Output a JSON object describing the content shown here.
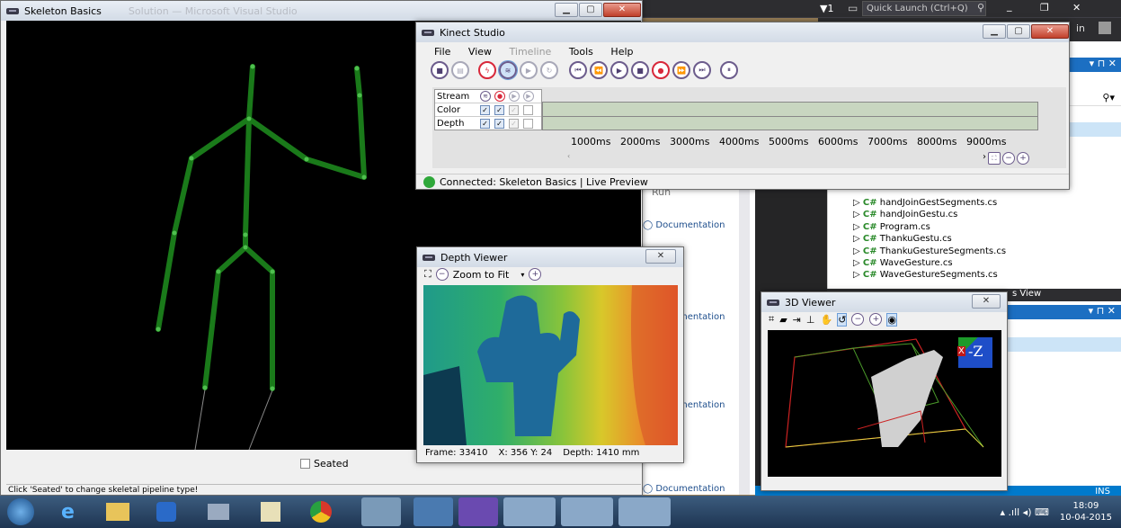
{
  "taskbar_top": {
    "badge": "▼1",
    "quick_launch": "Quick Launch (Ctrl+Q)",
    "user_partial": "in"
  },
  "skeleton": {
    "title": "Skeleton Basics",
    "title_ghost": "Solution — Microsoft Visual Studio",
    "seated_label": "Seated",
    "status": "Click 'Seated' to change skeletal pipeline type!"
  },
  "kinect": {
    "title": "Kinect Studio",
    "menu": [
      "File",
      "View",
      "Timeline",
      "Tools",
      "Help"
    ],
    "stream_rows": [
      {
        "label": "Stream"
      },
      {
        "label": "Color"
      },
      {
        "label": "Depth"
      }
    ],
    "ticks": [
      "1000ms",
      "2000ms",
      "3000ms",
      "4000ms",
      "5000ms",
      "6000ms",
      "7000ms",
      "8000ms",
      "9000ms"
    ],
    "status": "Connected:  Skeleton Basics | Live Preview"
  },
  "vs_mid": {
    "items": [
      "Run",
      "Documentation",
      "Documentation",
      "Documentation",
      "Documentation"
    ]
  },
  "solution": {
    "files": [
      "handJoinGestSegments.cs",
      "handJoinGestu.cs",
      "Program.cs",
      "ThankuGestu.cs",
      "ThankuGestureSegments.cs",
      "WaveGesture.cs",
      "WaveGestureSegments.cs"
    ],
    "tab_partial": "s View",
    "ins": "INS"
  },
  "depth": {
    "title": "Depth Viewer",
    "zoom": "Zoom to Fit",
    "frame": "Frame: 33410",
    "xy": "X: 356 Y: 24",
    "depth": "Depth: 1410 mm"
  },
  "viewer3d": {
    "title": "3D Viewer",
    "axis": "-Z",
    "axis2": "X"
  },
  "tray": {
    "time": "18:09",
    "date": "10-04-2015"
  }
}
